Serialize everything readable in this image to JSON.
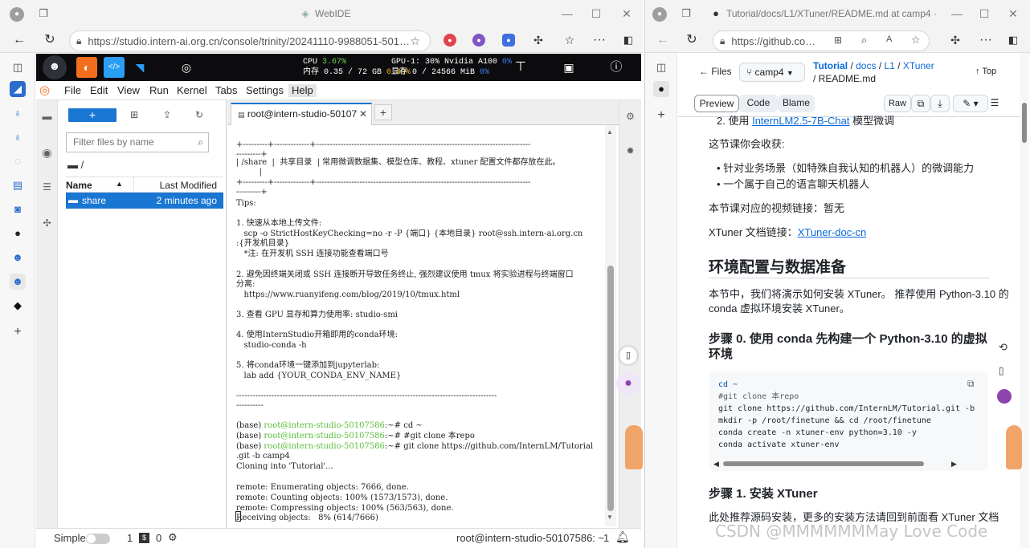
{
  "left_browser": {
    "title": "WebIDE",
    "url": "https://studio.intern-ai.org.cn/console/trinity/20241110-9988051-501…",
    "colors": {
      "accent": "#1976d2",
      "term_prompt": "#5bbf39"
    }
  },
  "studio": {
    "cpu_label": "CPU",
    "cpu_pct": "3.67%",
    "mem_label": "内存 0.35 / 72 GB",
    "mem_pct": "0.49%",
    "gpu_label": "GPU-1: 30% Nvidia A100",
    "gpu_pct": "0%",
    "vram_label": "显存 0 / 24566 MiB",
    "vram_pct": "0%"
  },
  "jupyter": {
    "menu": [
      "File",
      "Edit",
      "View",
      "Run",
      "Kernel",
      "Tabs",
      "Settings",
      "Help"
    ],
    "filter_placeholder": "Filter files by name",
    "breadcrumb": "/",
    "col_name": "Name",
    "col_modified": "Last Modified",
    "files": [
      {
        "name": "share",
        "modified": "2 minutes ago"
      }
    ],
    "tab_title": "root@intern-studio-50107",
    "status_mode": "Simple",
    "status_count1": "1",
    "status_count2": "0",
    "status_terminal": "root@intern-studio-50107586: ~",
    "status_count3": "1"
  },
  "terminal": {
    "lines": [
      {
        "t": "+---------+-------------+-------------------------------------------------------------------------------"
      },
      {
        "t": "---------+"
      },
      {
        "t": "| /share  |  共享目录  | 常用微调数据集、模型仓库、教程、xtuner 配置文件都存放在此。"
      },
      {
        "t": "         |"
      },
      {
        "t": "+---------+-------------+-------------------------------------------------------------------------------"
      },
      {
        "t": "---------+"
      },
      {
        "t": "Tips:"
      },
      {
        "t": ""
      },
      {
        "t": "1. 快速从本地上传文件:"
      },
      {
        "t": "   scp -o StrictHostKeyChecking=no -r -P {端口} {本地目录} root@ssh.intern-ai.org.cn"
      },
      {
        "t": ":{开发机目录}"
      },
      {
        "t": "   *注: 在开发机 SSH 连接功能查看端口号"
      },
      {
        "t": ""
      },
      {
        "t": "2. 避免因终端关闭或 SSH 连接断开导致任务终止, 强烈建议使用 tmux 将实验进程与终端窗口"
      },
      {
        "t": "分离:"
      },
      {
        "t": "   https://www.ruanyifeng.com/blog/2019/10/tmux.html"
      },
      {
        "t": ""
      },
      {
        "t": "3. 查看 GPU 显存和算力使用率: studio-smi"
      },
      {
        "t": ""
      },
      {
        "t": "4. 使用InternStudio开箱即用的conda环境:"
      },
      {
        "t": "   studio-conda -h"
      },
      {
        "t": ""
      },
      {
        "t": "5. 将conda环境一键添加到jupyterlab:"
      },
      {
        "t": "   lab add {YOUR_CONDA_ENV_NAME}"
      },
      {
        "t": ""
      },
      {
        "t": "------------------------------------------------------------------------------------------------"
      },
      {
        "t": "----------"
      },
      {
        "t": ""
      },
      {
        "p": "(base) ",
        "u": "root@intern-studio-50107586",
        "t": ":~# cd ~"
      },
      {
        "p": "(base) ",
        "u": "root@intern-studio-50107586",
        "t": ":~# #git clone 本repo"
      },
      {
        "p": "(base) ",
        "u": "root@intern-studio-50107586",
        "t": ":~# git clone https://github.com/InternLM/Tutorial"
      },
      {
        "t": ".git -b camp4"
      },
      {
        "t": "Cloning into 'Tutorial'..."
      },
      {
        "t": ""
      },
      {
        "t": "remote: Enumerating objects: 7666, done."
      },
      {
        "t": "remote: Counting objects: 100% (1573/1573), done."
      },
      {
        "t": "remote: Compressing objects: 100% (563/563), done."
      },
      {
        "t": "Receiving objects:   8% (614/7666)"
      }
    ]
  },
  "right_browser": {
    "title": "Tutorial/docs/L1/XTuner/README.md at camp4 · Intern…",
    "url": "https://github.co…",
    "files_label": "Files",
    "branch": "camp4",
    "crumbs": [
      "Tutorial",
      "docs",
      "L1",
      "XTuner"
    ],
    "crumb_file": "README.md",
    "top_label": "Top",
    "tabs": [
      "Preview",
      "Code",
      "Blame"
    ],
    "raw_label": "Raw",
    "item2_prefix": "2. 使用 ",
    "item2_link": "InternLM2.5-7B-Chat",
    "item2_suffix": " 模型微调",
    "gain_intro": "这节课你会收获:",
    "bullets": [
      "针对业务场景（如特殊自我认知的机器人）的微调能力",
      "一个属于自己的语言聊天机器人"
    ],
    "video": "本节课对应的视频链接：暂无",
    "doc_prefix": "XTuner 文档链接：",
    "doc_link": "XTuner-doc-cn",
    "h2": "环境配置与数据准备",
    "p1a": "本节中，我们将演示如何安装 XTuner。 推荐使用 Python-3.10 的",
    "p1b": "conda 虚拟环境安装 XTuner。",
    "h3a_1": "步骤 0. 使用 conda 先构建一个 Python-3.10 的虚拟",
    "h3a_2": "环境",
    "code": [
      "cd ~",
      "#git clone 本repo",
      "git clone https://github.com/InternLM/Tutorial.git -b ",
      "mkdir -p /root/finetune && cd /root/finetune",
      "conda create -n xtuner-env python=3.10 -y",
      "conda activate xtuner-env"
    ],
    "h3b": "步骤 1. 安装 XTuner",
    "p2": "此处推荐源码安装，更多的安装方法请回到前面看 XTuner 文档"
  },
  "watermark": "CSDN @MMMMMMMay Love Code"
}
